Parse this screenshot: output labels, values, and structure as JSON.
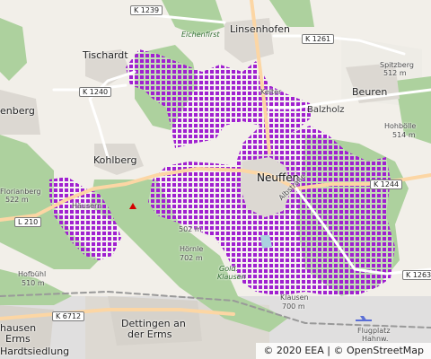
{
  "map": {
    "attribution": {
      "eea": "© 2020 EEA",
      "separator": "|",
      "osm": "© OpenStreetMap"
    },
    "overlay_color": "#9b17c9",
    "places": {
      "neuffen": "Neuffen",
      "linsenhofen": "Linsenhofen",
      "beuren": "Beuren",
      "tischardt": "Tischardt",
      "kohlberg": "Kohlberg",
      "balzholz": "Balzholz",
      "hausern": "Häusern",
      "dettingen_1": "Dettingen an",
      "dettingen_2": "der Erms",
      "enberg": "enberg",
      "hausen_1": "hausen",
      "hausen_2": "Erms",
      "hardtsiedlung": "Hardtsiedlung",
      "eichenfirst": "Eichenfirst",
      "kelter": "Kelter",
      "goldkl_1": "Gold.",
      "goldkl_2": "Klausen",
      "flugplatz_1": "Flugplatz",
      "flugplatz_2": "Hahnw."
    },
    "roads": {
      "k1239": "K 1239",
      "k1261": "K 1261",
      "k1240": "K 1240",
      "k1244": "K 1244",
      "k1263": "K 1263",
      "l210": "L 210",
      "k6712": "K 6712",
      "albstrasse": "Albstraße"
    },
    "peaks": {
      "spitzberg_name": "Spitzberg",
      "spitzberg_ele": "512 m",
      "hohboelle_name": "Hohbölle",
      "hohboelle_ele": "514 m",
      "florianberg_name": "Florianberg",
      "florianberg_ele": "522 m",
      "hofbuehl_name": "Hofbühl",
      "hofbuehl_ele": "510 m",
      "neuffen_ele": "502 m",
      "hoernle_name": "Hörnle",
      "hoernle_ele": "702 m",
      "klausen_name": "Klausen",
      "klausen_ele": "700 m"
    }
  }
}
